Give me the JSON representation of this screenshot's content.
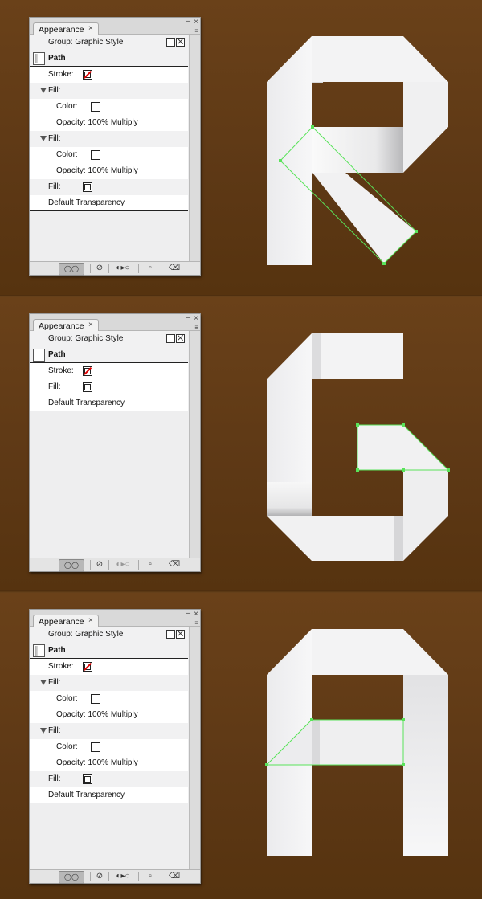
{
  "panels": [
    {
      "tab_label": "Appearance",
      "tab_close": "×",
      "win_min": "–",
      "win_close": "×",
      "menu_icon": "≡",
      "header": "Group: Graphic Style",
      "path_label": "Path",
      "stroke_label": "Stroke:",
      "fill1_label": "Fill:",
      "color1_label": "Color:",
      "opacity1": "Opacity: 100% Multiply",
      "fill2_label": "Fill:",
      "color2_label": "Color:",
      "opacity2": "Opacity: 100% Multiply",
      "fill3_label": "Fill:",
      "transparency": "Default Transparency",
      "bb_first": "◯◯",
      "bb_clear": "⊘",
      "bb_dup": "◐▸○",
      "bb_new": "▫",
      "bb_trash": "⌫"
    },
    {
      "tab_label": "Appearance",
      "tab_close": "×",
      "win_min": "–",
      "win_close": "×",
      "menu_icon": "≡",
      "header": "Group: Graphic Style",
      "path_label": "Path",
      "stroke_label": "Stroke:",
      "fill_label": "Fill:",
      "transparency": "Default Transparency",
      "bb_first": "◯◯",
      "bb_clear": "⊘",
      "bb_dup": "◐▸○",
      "bb_new": "▫",
      "bb_trash": "⌫"
    },
    {
      "tab_label": "Appearance",
      "tab_close": "×",
      "win_min": "–",
      "win_close": "×",
      "menu_icon": "≡",
      "header": "Group: Graphic Style",
      "path_label": "Path",
      "stroke_label": "Stroke:",
      "fill1_label": "Fill:",
      "color1_label": "Color:",
      "opacity1": "Opacity: 100% Multiply",
      "fill2_label": "Fill:",
      "color2_label": "Color:",
      "opacity2": "Opacity: 100% Multiply",
      "fill3_label": "Fill:",
      "transparency": "Default Transparency",
      "bb_first": "◯◯",
      "bb_clear": "⊘",
      "bb_dup": "◐▸○",
      "bb_new": "▫",
      "bb_trash": "⌫"
    }
  ],
  "colors": {
    "background": "#5f3a17",
    "paper": "#f2f2f3",
    "selection": "#59e35a",
    "stroke_none": "#dd0000"
  },
  "icons": [
    "close-icon",
    "minimize-icon",
    "panel-menu-icon",
    "disclosure-triangle-icon",
    "trash-icon",
    "clear-appearance-icon",
    "duplicate-item-icon",
    "new-art-icon"
  ]
}
